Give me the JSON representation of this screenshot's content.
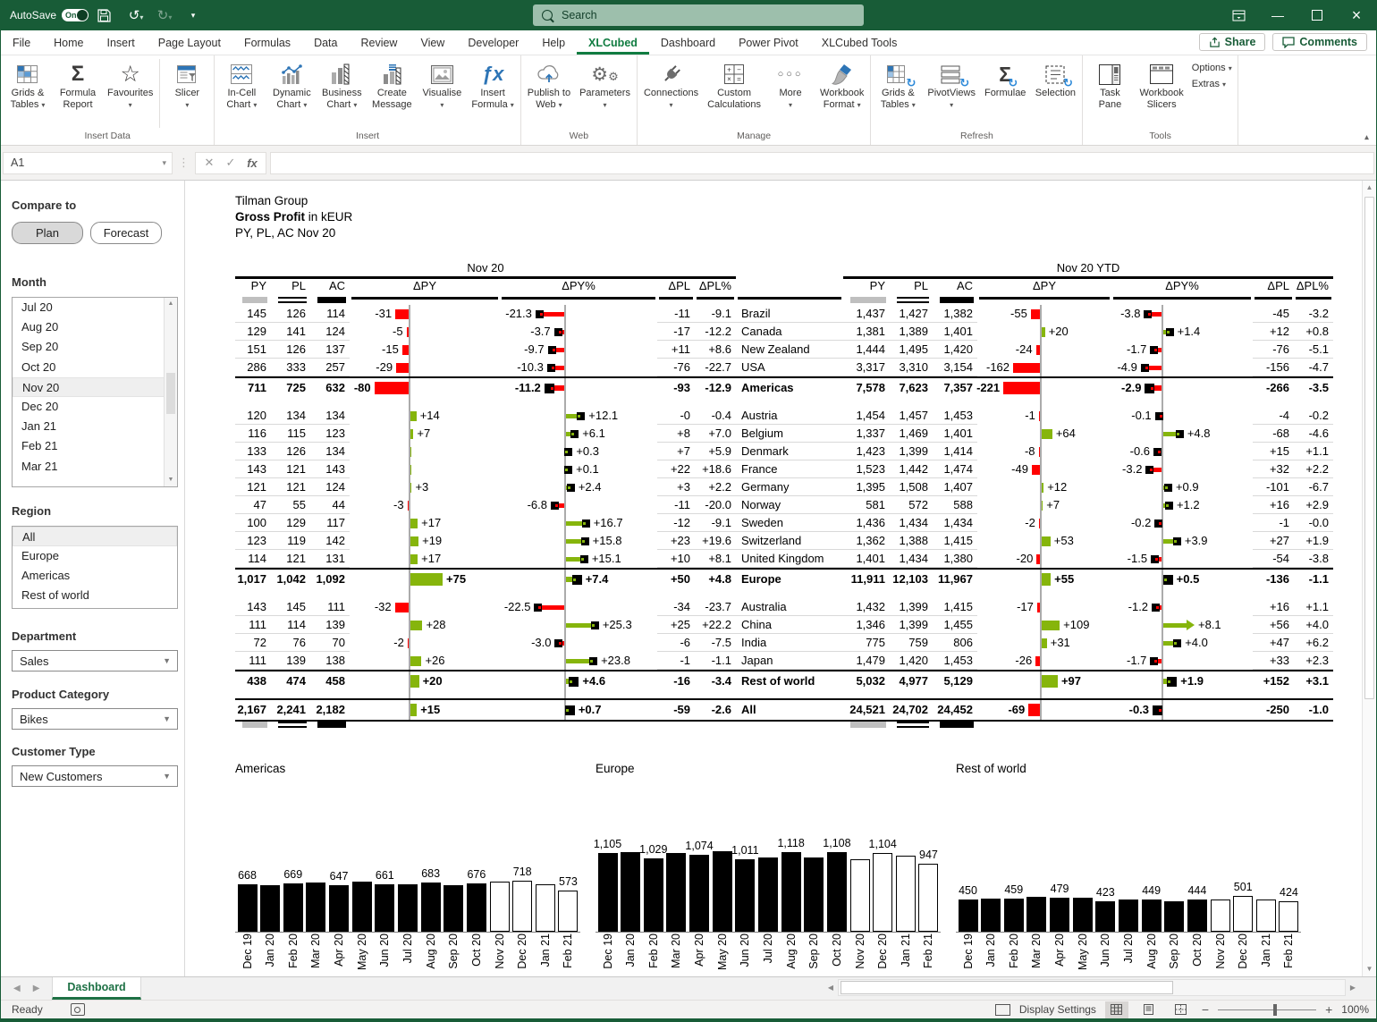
{
  "titlebar": {
    "autosave_label": "AutoSave",
    "autosave_state": "On",
    "search_placeholder": "Search"
  },
  "tabs": {
    "items": [
      "File",
      "Home",
      "Insert",
      "Page Layout",
      "Formulas",
      "Data",
      "Review",
      "View",
      "Developer",
      "Help",
      "XLCubed",
      "Dashboard",
      "Power Pivot",
      "XLCubed Tools"
    ],
    "active": "XLCubed",
    "share": "Share",
    "comments": "Comments"
  },
  "ribbon": {
    "groups": [
      {
        "label": "Insert Data",
        "buttons": [
          {
            "line1": "Grids &",
            "line2": "Tables",
            "icon": "grid-table",
            "chevron": true
          },
          {
            "line1": "Formula",
            "line2": "Report",
            "icon": "sigma",
            "chevron": false
          },
          {
            "line1": "Favourites",
            "line2": "",
            "icon": "star",
            "chevron": true
          },
          {
            "line1": "Slicer",
            "line2": "",
            "icon": "slicer",
            "chevron": true,
            "presep": true
          }
        ]
      },
      {
        "label": "Insert",
        "buttons": [
          {
            "line1": "In-Cell",
            "line2": "Chart",
            "icon": "incell-chart",
            "chevron": true
          },
          {
            "line1": "Dynamic",
            "line2": "Chart",
            "icon": "dynamic-chart",
            "chevron": true
          },
          {
            "line1": "Business",
            "line2": "Chart",
            "icon": "business-chart",
            "chevron": true
          },
          {
            "line1": "Create",
            "line2": "Message",
            "icon": "create-message",
            "chevron": false
          },
          {
            "line1": "Visualise",
            "line2": "",
            "icon": "visualise",
            "chevron": true
          },
          {
            "line1": "Insert",
            "line2": "Formula",
            "icon": "fx",
            "chevron": true
          }
        ]
      },
      {
        "label": "Web",
        "buttons": [
          {
            "line1": "Publish to",
            "line2": "Web",
            "icon": "publish-web",
            "chevron": true
          },
          {
            "line1": "Parameters",
            "line2": "",
            "icon": "parameters",
            "chevron": true
          }
        ]
      },
      {
        "label": "Manage",
        "buttons": [
          {
            "line1": "Connections",
            "line2": "",
            "icon": "connections",
            "chevron": true
          },
          {
            "line1": "Custom",
            "line2": "Calculations",
            "icon": "custom-calc",
            "chevron": false
          },
          {
            "line1": "More",
            "line2": "",
            "icon": "more",
            "chevron": true
          },
          {
            "line1": "Workbook",
            "line2": "Format",
            "icon": "format-brush",
            "chevron": true
          }
        ]
      },
      {
        "label": "Refresh",
        "buttons": [
          {
            "line1": "Grids &",
            "line2": "Tables",
            "icon": "refresh-grid",
            "chevron": true
          },
          {
            "line1": "PivotViews",
            "line2": "",
            "icon": "refresh-pivot",
            "chevron": true
          },
          {
            "line1": "Formulae",
            "line2": "",
            "icon": "refresh-formula",
            "chevron": false
          },
          {
            "line1": "Selection",
            "line2": "",
            "icon": "refresh-selection",
            "chevron": false
          }
        ]
      },
      {
        "label": "Tools",
        "buttons": [
          {
            "line1": "Task",
            "line2": "Pane",
            "icon": "task-pane",
            "chevron": false
          },
          {
            "line1": "Workbook",
            "line2": "Slicers",
            "icon": "workbook-slicers",
            "chevron": false
          }
        ],
        "menu_items": [
          {
            "label": "Options",
            "chevron": true
          },
          {
            "label": "Extras",
            "chevron": true
          }
        ]
      }
    ]
  },
  "formula_bar": {
    "name_box": "A1",
    "cancel": "✕",
    "enter": "✓",
    "fx": "fx"
  },
  "filters": {
    "compare_label": "Compare to",
    "plan": "Plan",
    "forecast": "Forecast",
    "compare_selected": "Plan",
    "month_label": "Month",
    "months": [
      "Jul 20",
      "Aug 20",
      "Sep 20",
      "Oct 20",
      "Nov 20",
      "Dec 20",
      "Jan 21",
      "Feb 21",
      "Mar 21"
    ],
    "month_selected": "Nov 20",
    "region_label": "Region",
    "regions": [
      "All",
      "Europe",
      "Americas",
      "Rest of world"
    ],
    "region_selected": "All",
    "department_label": "Department",
    "department_value": "Sales",
    "product_label": "Product Category",
    "product_value": "Bikes",
    "customer_label": "Customer Type",
    "customer_value": "New Customers"
  },
  "report": {
    "title1": "Tilman Group",
    "title2_bold": "Gross Profit",
    "title2_rest": " in kEUR",
    "title3": "PY, PL, AC Nov 20",
    "section1": "Nov 20",
    "section2": "Nov 20 YTD",
    "headers": [
      "PY",
      "PL",
      "AC",
      "ΔPY",
      "ΔPY%",
      "ΔPL",
      "ΔPL%"
    ],
    "groups": [
      {
        "rows": [
          {
            "name": "Brazil",
            "m": [
              "145",
              "126",
              "114",
              -31,
              "-31",
              -21.3,
              "-21.3",
              "-11",
              "-9.1"
            ],
            "y": [
              "1,437",
              "1,427",
              "1,382",
              -55,
              "-55",
              -3.8,
              "-3.8",
              "-45",
              "-3.2"
            ]
          },
          {
            "name": "Canada",
            "m": [
              "129",
              "141",
              "124",
              -5,
              "-5",
              -3.7,
              "-3.7",
              "-17",
              "-12.2"
            ],
            "y": [
              "1,381",
              "1,389",
              "1,401",
              20,
              "+20",
              1.4,
              "+1.4",
              "+12",
              "+0.8"
            ]
          },
          {
            "name": "New Zealand",
            "m": [
              "151",
              "126",
              "137",
              -15,
              "-15",
              -9.7,
              "-9.7",
              "+11",
              "+8.6"
            ],
            "y": [
              "1,444",
              "1,495",
              "1,420",
              -24,
              "-24",
              -1.7,
              "-1.7",
              "-76",
              "-5.1"
            ]
          },
          {
            "name": "USA",
            "m": [
              "286",
              "333",
              "257",
              -29,
              "-29",
              -10.3,
              "-10.3",
              "-76",
              "-22.7"
            ],
            "y": [
              "3,317",
              "3,310",
              "3,154",
              -162,
              "-162",
              -4.9,
              "-4.9",
              "-156",
              "-4.7"
            ]
          }
        ],
        "total": {
          "name": "Americas",
          "m": [
            "711",
            "725",
            "632",
            -80,
            "-80",
            -11.2,
            "-11.2",
            "-93",
            "-12.9"
          ],
          "y": [
            "7,578",
            "7,623",
            "7,357",
            -221,
            "-221",
            -2.9,
            "-2.9",
            "-266",
            "-3.5"
          ]
        }
      },
      {
        "rows": [
          {
            "name": "Austria",
            "m": [
              "120",
              "134",
              "134",
              14,
              "+14",
              12.1,
              "+12.1",
              "-0",
              "-0.4"
            ],
            "y": [
              "1,454",
              "1,457",
              "1,453",
              -1,
              "-1",
              -0.1,
              "-0.1",
              "-4",
              "-0.2"
            ]
          },
          {
            "name": "Belgium",
            "m": [
              "116",
              "115",
              "123",
              7,
              "+7",
              6.1,
              "+6.1",
              "+8",
              "+7.0"
            ],
            "y": [
              "1,337",
              "1,469",
              "1,401",
              64,
              "+64",
              4.8,
              "+4.8",
              "-68",
              "-4.6"
            ]
          },
          {
            "name": "Denmark",
            "m": [
              "133",
              "126",
              "134",
              1,
              "",
              0.3,
              "+0.3",
              "+7",
              "+5.9"
            ],
            "y": [
              "1,423",
              "1,399",
              "1,414",
              -8,
              "-8",
              -0.6,
              "-0.6",
              "+15",
              "+1.1"
            ]
          },
          {
            "name": "France",
            "m": [
              "143",
              "121",
              "143",
              0,
              "",
              0.1,
              "+0.1",
              "+22",
              "+18.6"
            ],
            "y": [
              "1,523",
              "1,442",
              "1,474",
              -49,
              "-49",
              -3.2,
              "-3.2",
              "+32",
              "+2.2"
            ]
          },
          {
            "name": "Germany",
            "m": [
              "121",
              "121",
              "124",
              3,
              "+3",
              2.4,
              "+2.4",
              "+3",
              "+2.2"
            ],
            "y": [
              "1,395",
              "1,508",
              "1,407",
              12,
              "+12",
              0.9,
              "+0.9",
              "-101",
              "-6.7"
            ]
          },
          {
            "name": "Norway",
            "m": [
              "47",
              "55",
              "44",
              -3,
              "-3",
              -6.8,
              "-6.8",
              "-11",
              "-20.0"
            ],
            "y": [
              "581",
              "572",
              "588",
              7,
              "+7",
              1.2,
              "+1.2",
              "+16",
              "+2.9"
            ]
          },
          {
            "name": "Sweden",
            "m": [
              "100",
              "129",
              "117",
              17,
              "+17",
              16.7,
              "+16.7",
              "-12",
              "-9.1"
            ],
            "y": [
              "1,436",
              "1,434",
              "1,434",
              -2,
              "-2",
              -0.2,
              "-0.2",
              "-1",
              "-0.0"
            ]
          },
          {
            "name": "Switzerland",
            "m": [
              "123",
              "119",
              "142",
              19,
              "+19",
              15.8,
              "+15.8",
              "+23",
              "+19.6"
            ],
            "y": [
              "1,362",
              "1,388",
              "1,415",
              53,
              "+53",
              3.9,
              "+3.9",
              "+27",
              "+1.9"
            ]
          },
          {
            "name": "United Kingdom",
            "m": [
              "114",
              "121",
              "131",
              17,
              "+17",
              15.1,
              "+15.1",
              "+10",
              "+8.1"
            ],
            "y": [
              "1,401",
              "1,434",
              "1,380",
              -20,
              "-20",
              -1.5,
              "-1.5",
              "-54",
              "-3.8"
            ]
          }
        ],
        "total": {
          "name": "Europe",
          "m": [
            "1,017",
            "1,042",
            "1,092",
            75,
            "+75",
            7.4,
            "+7.4",
            "+50",
            "+4.8"
          ],
          "y": [
            "11,911",
            "12,103",
            "11,967",
            55,
            "+55",
            0.5,
            "+0.5",
            "-136",
            "-1.1"
          ]
        }
      },
      {
        "rows": [
          {
            "name": "Australia",
            "m": [
              "143",
              "145",
              "111",
              -32,
              "-32",
              -22.5,
              "-22.5",
              "-34",
              "-23.7"
            ],
            "y": [
              "1,432",
              "1,399",
              "1,415",
              -17,
              "-17",
              -1.2,
              "-1.2",
              "+16",
              "+1.1"
            ]
          },
          {
            "name": "China",
            "m": [
              "111",
              "114",
              "139",
              28,
              "+28",
              25.3,
              "+25.3",
              "+25",
              "+22.2"
            ],
            "y": [
              "1,346",
              "1,399",
              "1,455",
              109,
              "+109",
              8.1,
              "+8.1",
              "+56",
              "+4.0"
            ]
          },
          {
            "name": "India",
            "m": [
              "72",
              "76",
              "70",
              -2,
              "-2",
              -3.0,
              "-3.0",
              "-6",
              "-7.5"
            ],
            "y": [
              "775",
              "759",
              "806",
              31,
              "+31",
              4.0,
              "+4.0",
              "+47",
              "+6.2"
            ]
          },
          {
            "name": "Japan",
            "m": [
              "111",
              "139",
              "138",
              26,
              "+26",
              23.8,
              "+23.8",
              "-1",
              "-1.1"
            ],
            "y": [
              "1,479",
              "1,420",
              "1,453",
              -26,
              "-26",
              -1.7,
              "-1.7",
              "+33",
              "+2.3"
            ]
          }
        ],
        "total": {
          "name": "Rest of world",
          "m": [
            "438",
            "474",
            "458",
            20,
            "+20",
            4.6,
            "+4.6",
            "-16",
            "-3.4"
          ],
          "y": [
            "5,032",
            "4,977",
            "5,129",
            97,
            "+97",
            1.9,
            "+1.9",
            "+152",
            "+3.1"
          ]
        }
      }
    ],
    "grand": {
      "name": "All",
      "m": [
        "2,167",
        "2,241",
        "2,182",
        15,
        "+15",
        0.7,
        "+0.7",
        "-59",
        "-2.6"
      ],
      "y": [
        "24,521",
        "24,702",
        "24,452",
        -69,
        "-69",
        -0.3,
        "-0.3",
        "-250",
        "-1.0"
      ]
    },
    "colors": {
      "positive": "#86B50C",
      "negative": "#FF0000",
      "axis": "#ABABAB",
      "py_mark": "#BFBFBF"
    }
  },
  "chart_data": [
    {
      "type": "bar",
      "title": "Americas",
      "categories": [
        "Dec 19",
        "Jan 20",
        "Feb 20",
        "Mar 20",
        "Apr 20",
        "May 20",
        "Jun 20",
        "Jul 20",
        "Aug 20",
        "Sep 20",
        "Oct 20",
        "Nov 20",
        "Dec 20",
        "Jan 21",
        "Feb 21"
      ],
      "values": [
        668,
        652,
        669,
        685,
        647,
        702,
        661,
        659,
        683,
        654,
        676,
        703,
        718,
        662,
        573
      ],
      "labeled_indices": [
        0,
        2,
        4,
        6,
        8,
        10,
        12,
        14
      ],
      "forecast_from_index": 11,
      "ylim": [
        0,
        1200
      ],
      "legend_position": "none",
      "grid": false
    },
    {
      "type": "bar",
      "title": "Europe",
      "categories": [
        "Dec 19",
        "Jan 20",
        "Feb 20",
        "Mar 20",
        "Apr 20",
        "May 20",
        "Jun 20",
        "Jul 20",
        "Aug 20",
        "Sep 20",
        "Oct 20",
        "Nov 20",
        "Dec 20",
        "Jan 21",
        "Feb 21"
      ],
      "values": [
        1105,
        1112,
        1029,
        1098,
        1074,
        1120,
        1011,
        1035,
        1118,
        1043,
        1108,
        1018,
        1104,
        1068,
        947
      ],
      "labeled_indices": [
        0,
        2,
        4,
        6,
        8,
        10,
        12,
        14
      ],
      "forecast_from_index": 11,
      "ylim": [
        0,
        1200
      ],
      "legend_position": "none",
      "grid": false
    },
    {
      "type": "bar",
      "title": "Rest of world",
      "categories": [
        "Dec 19",
        "Jan 20",
        "Feb 20",
        "Mar 20",
        "Apr 20",
        "May 20",
        "Jun 20",
        "Jul 20",
        "Aug 20",
        "Sep 20",
        "Oct 20",
        "Nov 20",
        "Dec 20",
        "Jan 21",
        "Feb 21"
      ],
      "values": [
        450,
        462,
        459,
        490,
        479,
        472,
        423,
        446,
        449,
        426,
        444,
        456,
        501,
        452,
        424
      ],
      "labeled_indices": [
        0,
        2,
        4,
        6,
        8,
        10,
        12,
        14
      ],
      "forecast_from_index": 11,
      "ylim": [
        0,
        1200
      ],
      "legend_position": "none",
      "grid": false
    }
  ],
  "sheet_tabs": {
    "active": "Dashboard"
  },
  "status": {
    "ready": "Ready",
    "display_settings": "Display Settings",
    "zoom": "100%"
  }
}
